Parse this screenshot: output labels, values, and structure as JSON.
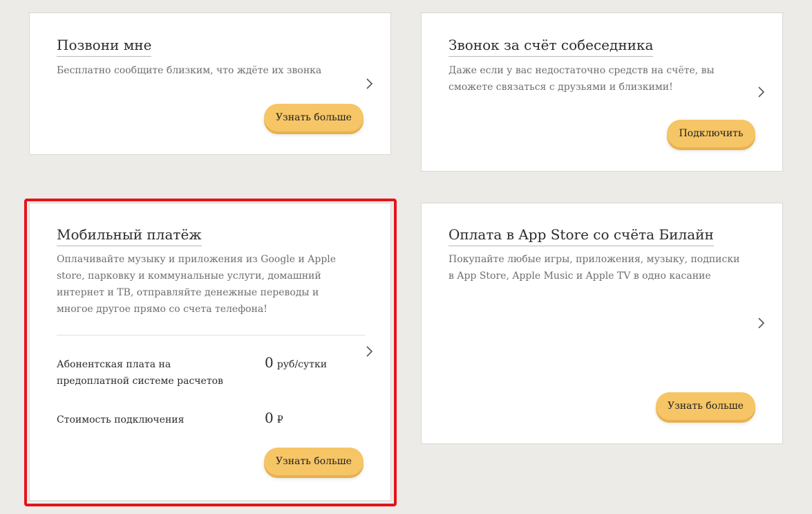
{
  "cards": [
    {
      "title": "Позвони мне",
      "description": "Бесплатно сообщите близким, что ждёте их звонка",
      "button": "Узнать больше"
    },
    {
      "title": "Звонок за счёт собеседника",
      "description": "Даже если у вас недостаточно средств на счёте, вы сможете связаться с друзьями и близкими!",
      "button": "Подключить"
    },
    {
      "title": "Мобильный платёж",
      "description": "Оплачивайте музыку и приложения из Google и Apple store, парковку и коммунальные услуги, домашний интернет и ТВ, отправляйте денежные переводы и многое другое прямо со счета телефона!",
      "rows": [
        {
          "label": "Абонентская плата на предоплатной системе расчетов",
          "value": "0",
          "unit": "руб/сутки"
        },
        {
          "label": "Стоимость подключения",
          "value": "0",
          "unit": "₽"
        }
      ],
      "button": "Узнать больше"
    },
    {
      "title": "Оплата в App Store со счёта Билайн",
      "description": "Покупайте любые игры, приложения, музыку, подписки в App Store, Apple Music и Apple TV в одно касание",
      "button": "Узнать больше"
    }
  ],
  "colors": {
    "accent_button": "#f6c566",
    "highlight": "#e5131a",
    "background": "#ecebe8"
  },
  "icons": {
    "chevron": "chevron-right-icon"
  }
}
